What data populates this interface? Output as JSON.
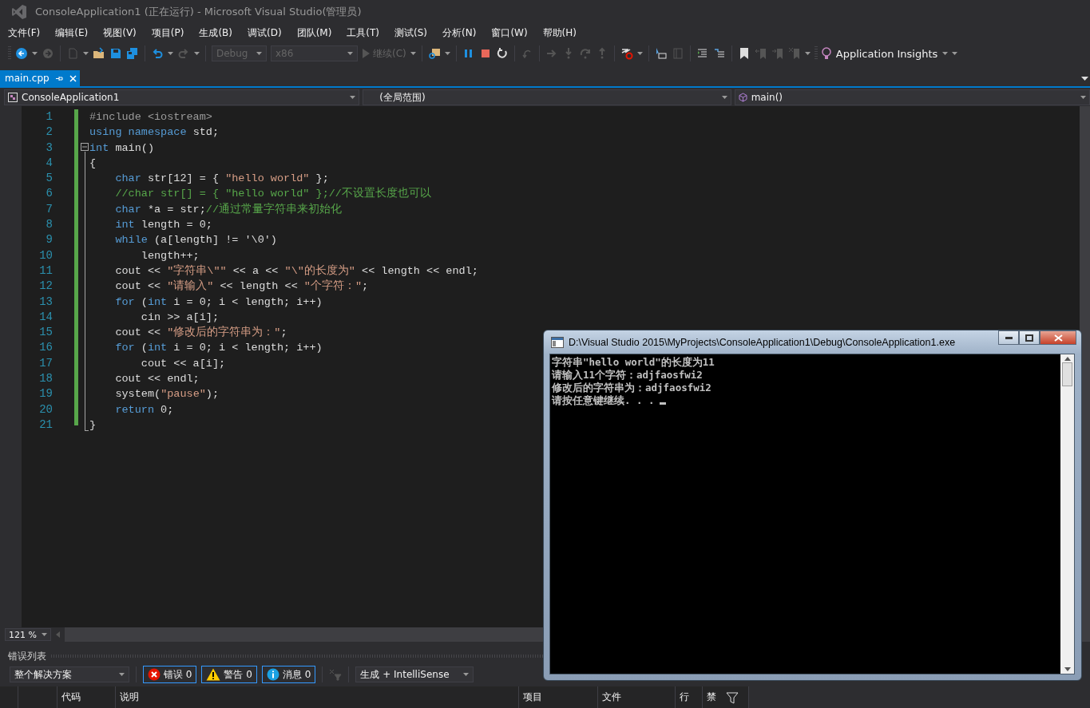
{
  "window": {
    "title": "ConsoleApplication1 (正在运行) - Microsoft Visual Studio(管理员)"
  },
  "menu": [
    "文件(F)",
    "编辑(E)",
    "视图(V)",
    "项目(P)",
    "生成(B)",
    "调试(D)",
    "团队(M)",
    "工具(T)",
    "测试(S)",
    "分析(N)",
    "窗口(W)",
    "帮助(H)"
  ],
  "toolbar": {
    "configuration": "Debug",
    "platform": "x86",
    "continue": "继续(C)",
    "insights": "Application Insights"
  },
  "tabs": [
    {
      "label": "main.cpp",
      "selected": true
    }
  ],
  "navigation": {
    "project": "ConsoleApplication1",
    "scope": "(全局范围)",
    "member": "main()"
  },
  "editor": {
    "zoom": "121 %",
    "lines": [
      {
        "number": "1",
        "tokens": [
          {
            "kind": "pre",
            "text": "#include <iostream>"
          }
        ]
      },
      {
        "number": "2",
        "tokens": [
          {
            "kind": "kw",
            "text": "using"
          },
          {
            "kind": "kw",
            "text": " namespace"
          },
          {
            "kind": "text",
            "text": " std;"
          }
        ]
      },
      {
        "number": "3",
        "tokens": [
          {
            "kind": "kw",
            "text": "int"
          },
          {
            "kind": "text",
            "text": " main()"
          }
        ]
      },
      {
        "number": "4",
        "tokens": [
          {
            "kind": "text",
            "text": "{"
          }
        ]
      },
      {
        "number": "5",
        "tokens": [
          {
            "kind": "kw",
            "text": "    char"
          },
          {
            "kind": "text",
            "text": " str[12] = { "
          },
          {
            "kind": "str",
            "text": "\"hello world\""
          },
          {
            "kind": "text",
            "text": " };"
          }
        ]
      },
      {
        "number": "6",
        "tokens": [
          {
            "kind": "comment",
            "text": "    //char str[] = { \"hello world\" };//不设置长度也可以"
          }
        ]
      },
      {
        "number": "7",
        "tokens": [
          {
            "kind": "kw",
            "text": "    char"
          },
          {
            "kind": "text",
            "text": " *a = str;"
          },
          {
            "kind": "comment",
            "text": "//通过常量字符串来初始化"
          }
        ]
      },
      {
        "number": "8",
        "tokens": [
          {
            "kind": "kw",
            "text": "    int"
          },
          {
            "kind": "text",
            "text": " length = 0;"
          }
        ]
      },
      {
        "number": "9",
        "tokens": [
          {
            "kind": "kw",
            "text": "    while"
          },
          {
            "kind": "text",
            "text": " (a[length] != '\\0')"
          }
        ]
      },
      {
        "number": "10",
        "tokens": [
          {
            "kind": "text",
            "text": "        length++;"
          }
        ]
      },
      {
        "number": "11",
        "tokens": [
          {
            "kind": "text",
            "text": "    cout << "
          },
          {
            "kind": "str",
            "text": "\"字符串\\\"\""
          },
          {
            "kind": "text",
            "text": " << a << "
          },
          {
            "kind": "str",
            "text": "\"\\\"的长度为\""
          },
          {
            "kind": "text",
            "text": " << length << endl;"
          }
        ]
      },
      {
        "number": "12",
        "tokens": [
          {
            "kind": "text",
            "text": "    cout << "
          },
          {
            "kind": "str",
            "text": "\"请输入\""
          },
          {
            "kind": "text",
            "text": " << length << "
          },
          {
            "kind": "str",
            "text": "\"个字符：\""
          },
          {
            "kind": "text",
            "text": ";"
          }
        ]
      },
      {
        "number": "13",
        "tokens": [
          {
            "kind": "kw",
            "text": "    for"
          },
          {
            "kind": "text",
            "text": " ("
          },
          {
            "kind": "kw",
            "text": "int"
          },
          {
            "kind": "text",
            "text": " i = 0; i < length; i++)"
          }
        ]
      },
      {
        "number": "14",
        "tokens": [
          {
            "kind": "text",
            "text": "        cin >> a[i];"
          }
        ]
      },
      {
        "number": "15",
        "tokens": [
          {
            "kind": "text",
            "text": "    cout << "
          },
          {
            "kind": "str",
            "text": "\"修改后的字符串为：\""
          },
          {
            "kind": "text",
            "text": ";"
          }
        ]
      },
      {
        "number": "16",
        "tokens": [
          {
            "kind": "kw",
            "text": "    for"
          },
          {
            "kind": "text",
            "text": " ("
          },
          {
            "kind": "kw",
            "text": "int"
          },
          {
            "kind": "text",
            "text": " i = 0; i < length; i++)"
          }
        ]
      },
      {
        "number": "17",
        "tokens": [
          {
            "kind": "text",
            "text": "        cout << a[i];"
          }
        ]
      },
      {
        "number": "18",
        "tokens": [
          {
            "kind": "text",
            "text": "    cout << endl;"
          }
        ]
      },
      {
        "number": "19",
        "tokens": [
          {
            "kind": "text",
            "text": "    system("
          },
          {
            "kind": "str",
            "text": "\"pause\""
          },
          {
            "kind": "text",
            "text": ");"
          }
        ]
      },
      {
        "number": "20",
        "tokens": [
          {
            "kind": "kw",
            "text": "    return"
          },
          {
            "kind": "text",
            "text": " 0;"
          }
        ]
      },
      {
        "number": "21",
        "tokens": [
          {
            "kind": "text",
            "text": "}"
          }
        ]
      }
    ]
  },
  "console": {
    "title": "D:\\Visual Studio 2015\\MyProjects\\ConsoleApplication1\\Debug\\ConsoleApplication1.exe",
    "output": [
      "字符串\"hello world\"的长度为11",
      "请输入11个字符：adjfaosfwi2",
      "修改后的字符串为：adjfaosfwi2",
      "请按任意键继续. . ."
    ]
  },
  "error_list": {
    "title": "错误列表",
    "scope": "整个解决方案",
    "filters": [
      {
        "kind": "error",
        "label": "错误 0",
        "selected": true
      },
      {
        "kind": "warning",
        "label": "警告 0",
        "selected": true
      },
      {
        "kind": "info",
        "label": "消息 0",
        "selected": true
      }
    ],
    "source": "生成 + IntelliSense",
    "columns": [
      "代码",
      "说明",
      "项目",
      "文件",
      "行",
      "禁"
    ]
  }
}
